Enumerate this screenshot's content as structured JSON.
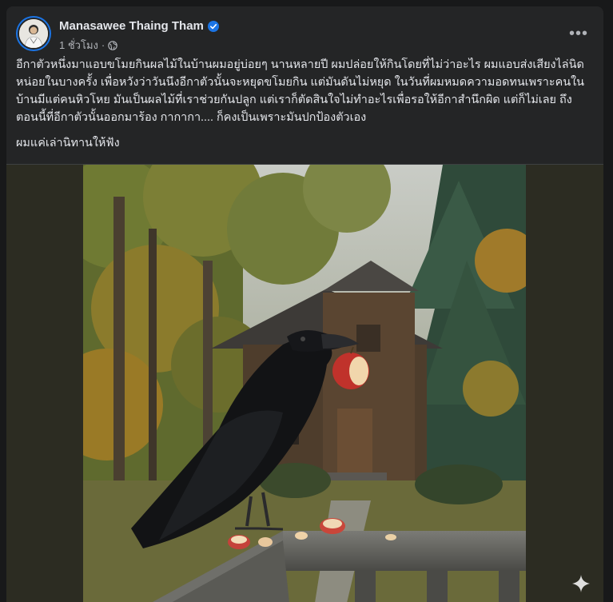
{
  "post": {
    "author": "Manasawee Thaing Tham",
    "time": "1 ชั่วโมง",
    "separator": "·",
    "more_label": "•••",
    "paragraph1": "อีกาตัวหนึ่งมาแอบขโมยกินผลไม้ในบ้านผมอยู่บ่อยๆ นานหลายปี ผมปล่อยให้กินโดยที่ไม่ว่าอะไร ผมแอบส่งเสียงไล่นิดหน่อยในบางครั้ง เพื่อหวังว่าวันนึงอีกาตัวนั้นจะหยุดขโมยกิน แต่มันดันไม่หยุด ในวันที่ผมหมดความอดทนเพราะคนในบ้านมีแต่คนหิวโหย มันเป็นผลไม้ที่เราช่วยกันปลูก แต่เราก็ตัดสินใจไม่ทำอะไรเพื่อรอให้อีกาสำนึกผิด แต่ก็ไม่เลย ถึงตอนนี้ที่อีกาตัวนั้นออกมาร้อง กากากา.... ก็คงเป็นเพราะมันปกป้องตัวเอง",
    "paragraph2": "ผมแค่เล่านิทานให้ฟัง"
  },
  "icons": {
    "verified": "verified-badge-icon",
    "audience": "globe-icon",
    "more": "more-options-icon",
    "sparkle": "ai-sparkle-icon"
  },
  "colors": {
    "background": "#18191a",
    "card": "#242526",
    "text": "#e4e6eb",
    "secondary_text": "#b0b3b8",
    "verified_blue": "#1b74e4"
  }
}
